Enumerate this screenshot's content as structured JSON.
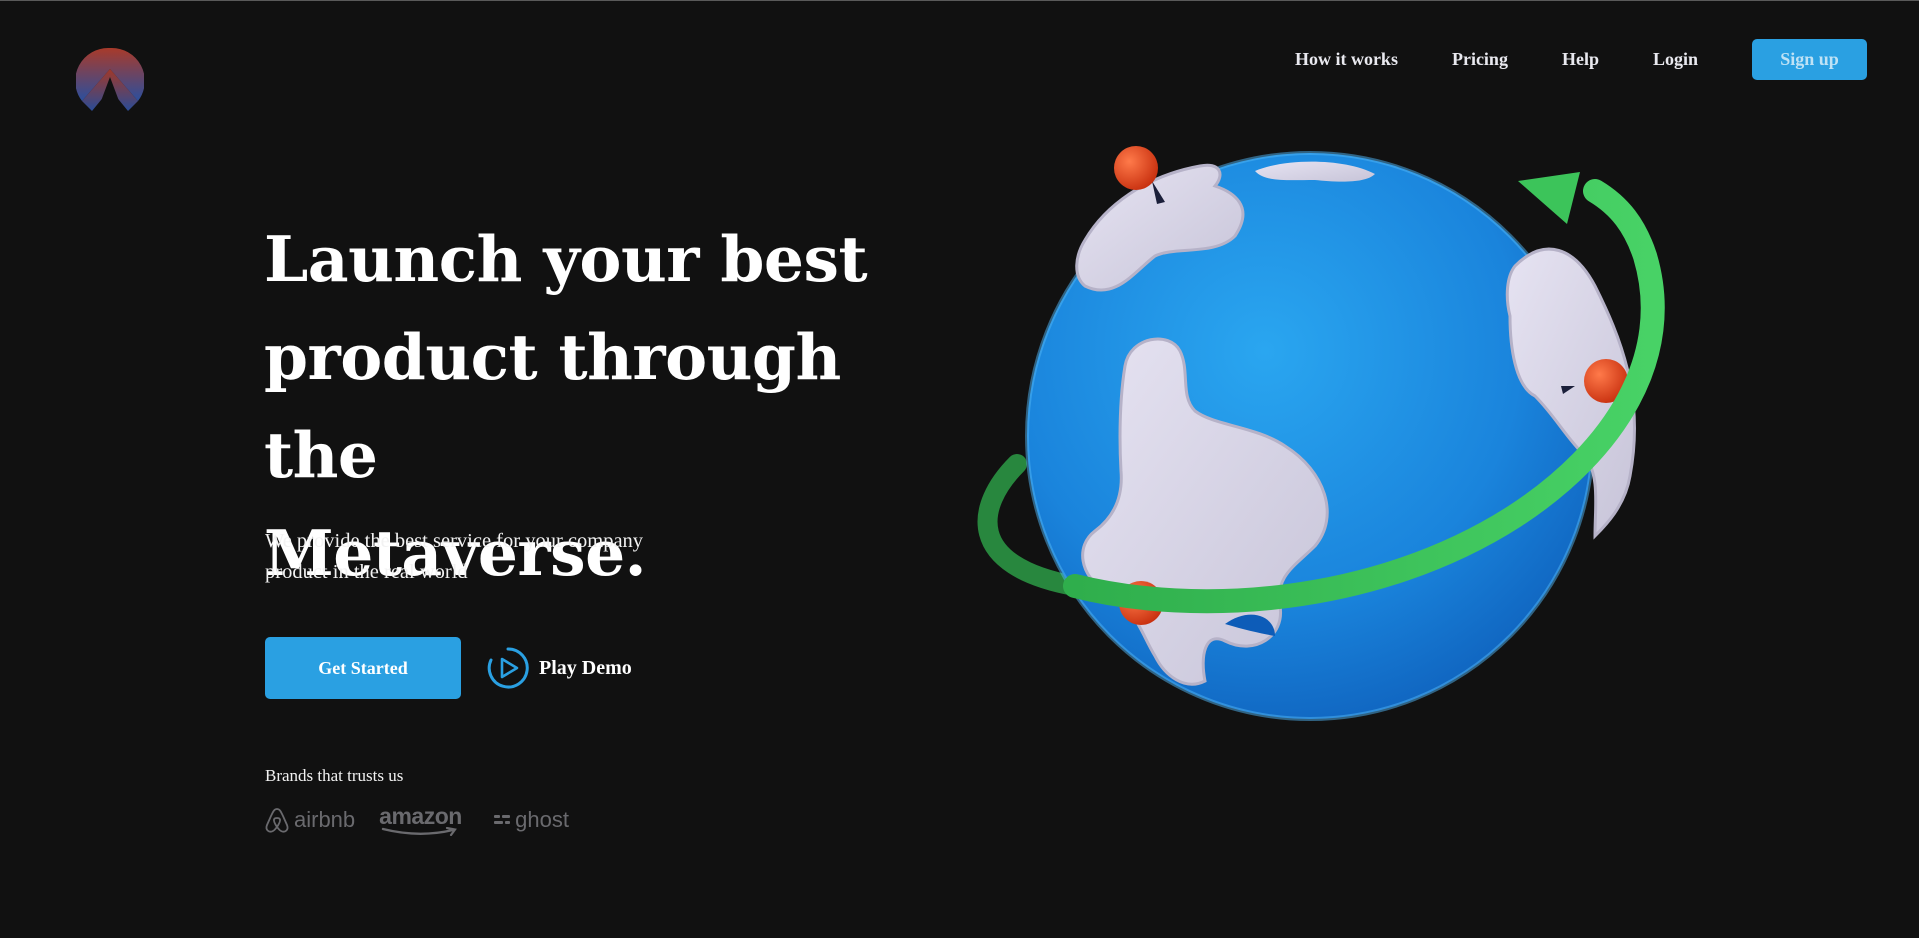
{
  "nav": {
    "links": [
      "How it works",
      "Pricing",
      "Help",
      "Login"
    ],
    "signup_label": "Sign up"
  },
  "hero": {
    "title_lines": [
      "Launch your best",
      "product through the",
      "Metaverse."
    ],
    "subtitle_lines": [
      "We provide the best service for your company",
      "product in the real world"
    ],
    "cta_label": "Get Started",
    "demo_label": "Play Demo"
  },
  "brands": {
    "title": "Brands that trusts us",
    "items": [
      "airbnb",
      "amazon",
      "ghost"
    ]
  },
  "colors": {
    "background": "#111111",
    "accent": "#2aa0e2",
    "arrow": "#3cc45a",
    "globe": "#1e8fe0",
    "pin": "#e23f1c"
  },
  "icons": {
    "logo": "mountain-sun-logo",
    "demo": "play-circle-icon",
    "illustration": "globe-orbit-illustration"
  }
}
